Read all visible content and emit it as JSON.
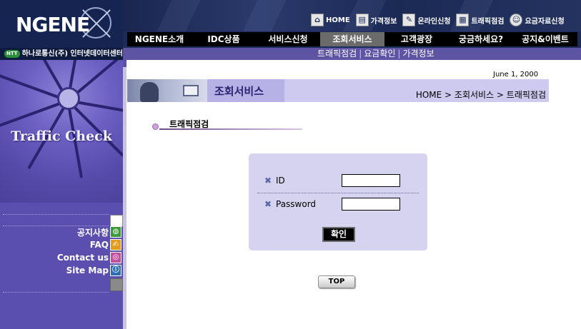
{
  "header": {
    "logo": "NGENE",
    "company": "하나로통신(주) 인터넷데이터센터",
    "company_badge": "NTT",
    "top_links": [
      {
        "label": "HOME",
        "icon": "home-icon"
      },
      {
        "label": "가격정보",
        "icon": "price-icon"
      },
      {
        "label": "온라인신청",
        "icon": "online-apply-icon"
      },
      {
        "label": "트래픽점검",
        "icon": "traffic-icon"
      },
      {
        "label": "요금자료신청",
        "icon": "billing-icon"
      }
    ],
    "main_nav": [
      "NGENE소개",
      "IDC상품",
      "서비스신청",
      "조회서비스",
      "고객광장",
      "궁금하세요?",
      "공지&이벤트"
    ],
    "main_nav_active": "조회서비스",
    "sub_nav": [
      "트래픽점검",
      "요금확인",
      "가격정보"
    ]
  },
  "sidebar": {
    "title": "Traffic Check",
    "links": [
      {
        "label": "공지사항",
        "icon": "notice-icon"
      },
      {
        "label": "FAQ",
        "icon": "faq-icon"
      },
      {
        "label": "Contact us",
        "icon": "contact-icon"
      },
      {
        "label": "Site Map",
        "icon": "sitemap-icon"
      }
    ]
  },
  "content": {
    "date": "June  1, 2000",
    "banner_title": "조회서비스",
    "breadcrumb": "HOME > 조회서비스 > 트래픽점검",
    "section_title": "트래픽점검",
    "login": {
      "id_label": "ID",
      "id_value": "",
      "password_label": "Password",
      "password_value": "",
      "confirm_label": "확인"
    },
    "top_button": "TOP"
  },
  "colors": {
    "header_bg": "#1c2b59",
    "nav_bg": "#000000",
    "nav_active": "#6b6b6b",
    "subnav_bg": "#5d55a3",
    "sidebar_bg": "#5a4fae",
    "banner_bg": "#cdc9ef",
    "login_bg": "#d5d3ef"
  }
}
